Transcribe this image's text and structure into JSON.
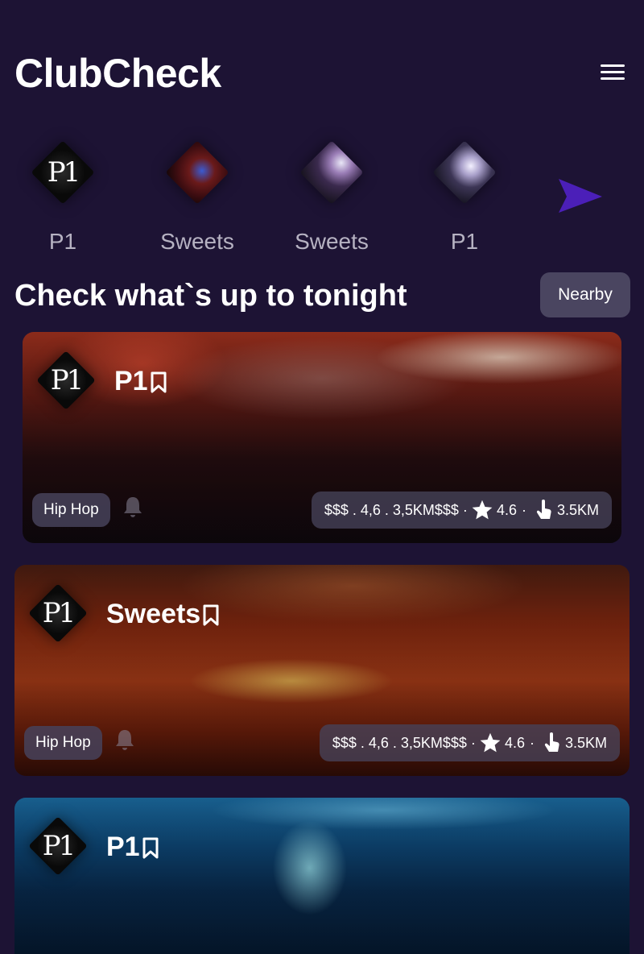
{
  "app": {
    "title": "ClubCheck"
  },
  "stories": [
    {
      "label": "P1",
      "image": "p1-logo"
    },
    {
      "label": "Sweets",
      "image": "red-club-photo"
    },
    {
      "label": "Sweets",
      "image": "crowd-photo"
    },
    {
      "label": "P1",
      "image": "crowd-photo"
    }
  ],
  "logo_text": "P1",
  "section": {
    "title": "Check what`s up to tonight",
    "nearby_label": "Nearby"
  },
  "cards": [
    {
      "name": "P1",
      "genre": "Hip Hop",
      "info": "$$$ . 4,6 . 3,5KM$$$ ·",
      "rating": "4.6",
      "sep": "·",
      "distance": "3.5KM"
    },
    {
      "name": "Sweets",
      "genre": "Hip Hop",
      "info": "$$$ . 4,6 . 3,5KM$$$ ·",
      "rating": "4.6",
      "sep": "·",
      "distance": "3.5KM"
    },
    {
      "name": "P1"
    }
  ],
  "colors": {
    "background": "#1d1334",
    "accent": "#4b1fb8",
    "pill": "#4a4560"
  },
  "icons": [
    "menu-icon",
    "send-arrow-icon",
    "bookmark-icon",
    "bell-icon",
    "star-icon",
    "tap-icon"
  ]
}
